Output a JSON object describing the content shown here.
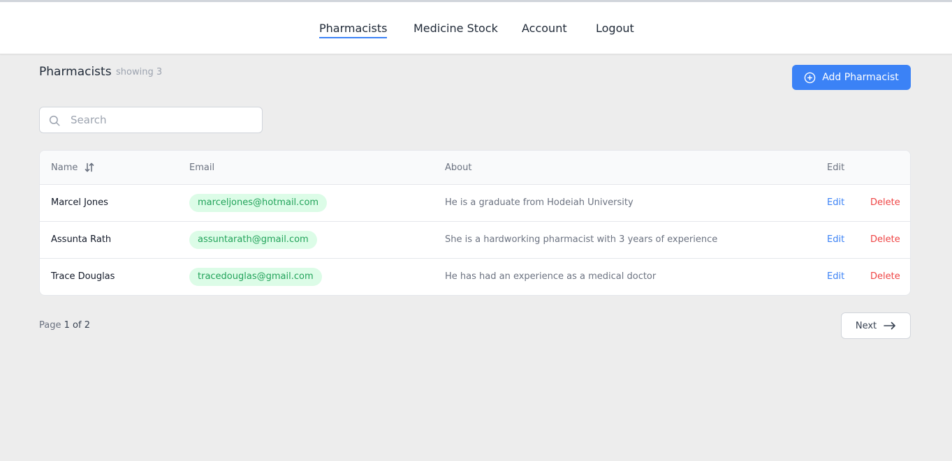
{
  "nav": {
    "items": [
      {
        "label": "Pharmacists",
        "active": true
      },
      {
        "label": "Medicine Stock",
        "active": false
      },
      {
        "label": "Account",
        "active": false
      },
      {
        "label": "Logout",
        "active": false
      }
    ]
  },
  "header": {
    "title": "Pharmacists",
    "count_text": "showing 3",
    "add_button_label": "Add Pharmacist",
    "add_button_icon": "plus-circle-icon"
  },
  "search": {
    "placeholder": "Search",
    "value": "",
    "icon": "search-icon"
  },
  "table": {
    "columns": [
      "Name",
      "Email",
      "About",
      "Edit"
    ],
    "sort_icon": "sort-icon",
    "rows": [
      {
        "name": "Marcel Jones",
        "email": "marceljones@hotmail.com",
        "about": "He is a graduate from Hodeiah University",
        "edit": "Edit",
        "delete": "Delete"
      },
      {
        "name": "Assunta Rath",
        "email": "assuntarath@gmail.com",
        "about": "She is a hardworking pharmacist with 3 years of experience",
        "edit": "Edit",
        "delete": "Delete"
      },
      {
        "name": "Trace Douglas",
        "email": "tracedouglas@gmail.com",
        "about": "He has had an experience as a medical doctor",
        "edit": "Edit",
        "delete": "Delete"
      }
    ]
  },
  "pagination": {
    "page_prefix": "Page",
    "page_text": "1 of 2",
    "next_label": "Next",
    "next_icon": "arrow-right-icon"
  },
  "colors": {
    "accent": "#3b82f6",
    "danger": "#ef4444",
    "email_pill_bg": "#dcfce7",
    "email_pill_text": "#22a35a"
  }
}
